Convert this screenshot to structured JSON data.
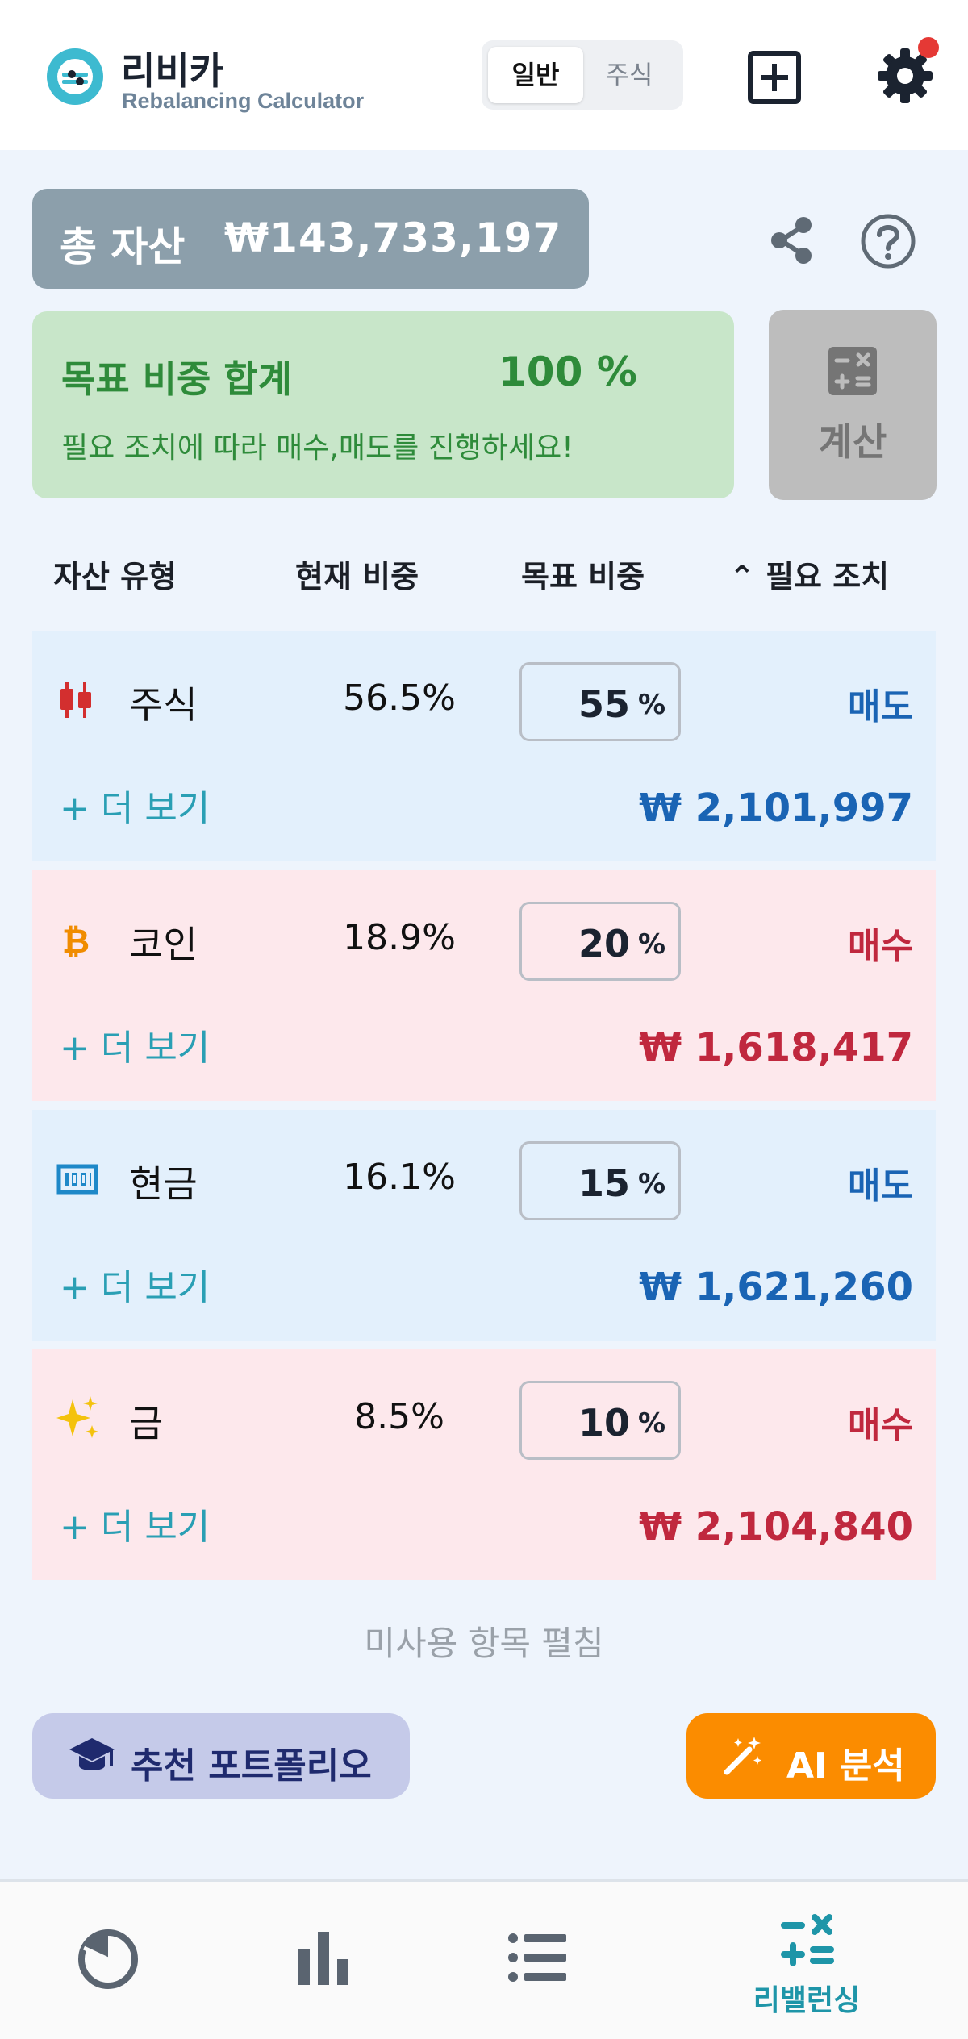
{
  "header": {
    "app_name": "리비카",
    "app_subtitle": "Rebalancing Calculator",
    "mode_tabs": [
      {
        "label": "일반",
        "selected": true
      },
      {
        "label": "주식",
        "selected": false
      }
    ]
  },
  "summary": {
    "total_label": "총 자산",
    "total_value": "₩143,733,197",
    "target_sum_label": "목표 비중 합계",
    "target_sum_value": "100 %",
    "message": "필요 조치에 따라 매수,매도를 진행하세요!",
    "calc_label": "계산"
  },
  "table": {
    "headers": {
      "asset_type": "자산 유형",
      "current_weight": "현재 비중",
      "target_weight": "목표 비중",
      "action": "⌃ 필요 조치"
    },
    "rows": [
      {
        "name": "주식",
        "icon": "candlestick-icon",
        "current": "56.5%",
        "target": "55",
        "unit": "%",
        "action": "매도",
        "more": "+ 더 보기",
        "amount": "₩ 2,101,997",
        "type": "sell"
      },
      {
        "name": "코인",
        "icon": "bitcoin-icon",
        "current": "18.9%",
        "target": "20",
        "unit": "%",
        "action": "매수",
        "more": "+ 더 보기",
        "amount": "₩ 1,618,417",
        "type": "buy"
      },
      {
        "name": "현금",
        "icon": "banknote-icon",
        "current": "16.1%",
        "target": "15",
        "unit": "%",
        "action": "매도",
        "more": "+ 더 보기",
        "amount": "₩ 1,621,260",
        "type": "sell"
      },
      {
        "name": "금",
        "icon": "sparkles-icon",
        "current": "8.5%",
        "target": "10",
        "unit": "%",
        "action": "매수",
        "more": "+ 더 보기",
        "amount": "₩ 2,104,840",
        "type": "buy"
      }
    ],
    "unused_toggle": "미사용 항목 펼침"
  },
  "buttons": {
    "recommend": "추천 포트폴리오",
    "ai": "AI 분석"
  },
  "nav": {
    "active_label": "리밸런싱"
  },
  "colors": {
    "sell": "#1a64b4",
    "buy": "#c0283e",
    "accent": "#1e95a8",
    "ai_button": "#fb8c00"
  }
}
